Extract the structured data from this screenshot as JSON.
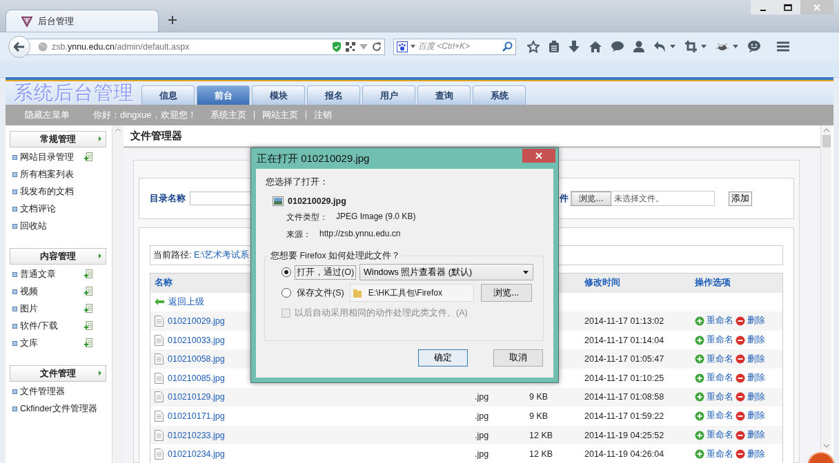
{
  "browser": {
    "tab_title": "后台管理",
    "url": "zsb.**ynnu.edu.cn**/admin/default.aspx",
    "search_placeholder": "百度 <Ctrl+K>"
  },
  "header": {
    "logo": "系统后台管理",
    "tabs": [
      {
        "label": "信息",
        "selected": false
      },
      {
        "label": "前台",
        "selected": true
      },
      {
        "label": "模块",
        "selected": false
      },
      {
        "label": "报名",
        "selected": false
      },
      {
        "label": "用户",
        "selected": false
      },
      {
        "label": "查询",
        "selected": false
      },
      {
        "label": "系统",
        "selected": false
      }
    ]
  },
  "topbar": {
    "hide_menu": "隐藏左菜单",
    "greeting": "你好：dingxue，欢迎您！",
    "links": [
      "系统主页",
      "网站主页",
      "注销"
    ]
  },
  "sidebar": {
    "groups": [
      {
        "title": "常规管理",
        "items": [
          {
            "label": "网站目录管理",
            "kind": "add"
          },
          {
            "label": "所有档案列表",
            "kind": "plain"
          },
          {
            "label": "我发布的文档",
            "kind": "plain"
          },
          {
            "label": "文档评论",
            "kind": "plain"
          },
          {
            "label": "回收站",
            "kind": "plain"
          }
        ]
      },
      {
        "title": "内容管理",
        "items": [
          {
            "label": "普通文章",
            "kind": "add"
          },
          {
            "label": "视频",
            "kind": "add"
          },
          {
            "label": "图片",
            "kind": "add"
          },
          {
            "label": "软件/下载",
            "kind": "add"
          },
          {
            "label": "文库",
            "kind": "add"
          }
        ]
      },
      {
        "title": "文件管理",
        "items": [
          {
            "label": "文件管理器",
            "kind": "plain"
          },
          {
            "label": "Ckfinder文件管理器",
            "kind": "plain"
          }
        ]
      }
    ]
  },
  "main": {
    "title": "文件管理器",
    "form": {
      "dir_label": "目录名称",
      "file_label": "件",
      "browse": "浏览…",
      "no_file": "未选择文件。",
      "add": "添加"
    },
    "path_label": "当前路径:",
    "path": "E:\\艺术考试系",
    "columns": {
      "name": "名称",
      "modified": "修改时间",
      "actions": "操作选项"
    },
    "up_link": "返回上级",
    "rows": [
      {
        "name": "010210029.jpg",
        "modified": "2014-11-17 01:13:02",
        "rename": "重命名",
        "delete": "删除"
      },
      {
        "name": "010210033.jpg",
        "modified": "2014-11-17 01:14:04",
        "rename": "重命名",
        "delete": "删除"
      },
      {
        "name": "010210058.jpg",
        "modified": "2014-11-17 01:05:47",
        "rename": "重命名",
        "delete": "删除"
      },
      {
        "name": "010210085.jpg",
        "modified": "2014-11-17 01:10:25",
        "rename": "重命名",
        "delete": "删除"
      },
      {
        "name": "010210129.jpg",
        "ext": ".jpg",
        "size": "9 KB",
        "modified": "2014-11-17 01:08:58",
        "rename": "重命名",
        "delete": "删除"
      },
      {
        "name": "010210171.jpg",
        "ext": ".jpg",
        "size": "9 KB",
        "modified": "2014-11-17 01:59:22",
        "rename": "重命名",
        "delete": "删除"
      },
      {
        "name": "010210233.jpg",
        "ext": ".jpg",
        "size": "12 KB",
        "modified": "2014-11-19 04:25:52",
        "rename": "重命名",
        "delete": "删除"
      },
      {
        "name": "010210234.jpg",
        "ext": ".jpg",
        "size": "12 KB",
        "modified": "2014-11-19 04:26:04",
        "rename": "重命名",
        "delete": "删除"
      }
    ]
  },
  "dialog": {
    "title": "正在打开 010210029.jpg",
    "intro": "您选择了打开：",
    "file": "010210029.jpg",
    "type_label": "文件类型：",
    "type": "JPEG Image (9.0 KB)",
    "source_label": "来源：",
    "source": "http://zsb.ynnu.edu.cn",
    "legend": "您想要 Firefox 如何处理此文件？",
    "options": [
      {
        "kind": "open",
        "label": "打开，通过(O)",
        "selected": true,
        "value": "Windows 照片查看器 (默认)"
      },
      {
        "kind": "save",
        "label": "保存文件(S)",
        "selected": false,
        "value": "E:\\HK工具包\\Firefox",
        "browse": "浏览..."
      }
    ],
    "remember": {
      "label": "以后自动采用相同的动作处理此类文件。(A)",
      "checked": false,
      "disabled": true
    },
    "buttons": [
      {
        "label": "确定",
        "default": true
      },
      {
        "label": "取消",
        "default": false
      }
    ]
  }
}
